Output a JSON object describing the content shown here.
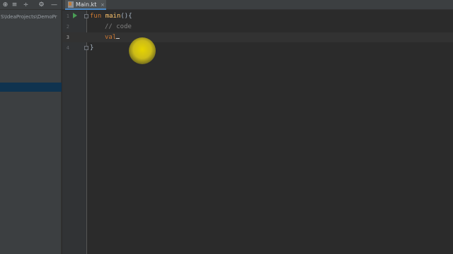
{
  "project_panel": {
    "toolbar_icons": [
      "target-icon",
      "expand-all-icon",
      "collapse-all-icon",
      "gear-icon",
      "minimize-icon"
    ],
    "path_text": "S\\IdeaProjects\\DemoPr"
  },
  "tabs": [
    {
      "label": "Main.kt",
      "close": "×",
      "icon": "kotlin-file-icon"
    }
  ],
  "editor": {
    "line_numbers": [
      "1",
      "2",
      "3",
      "4"
    ],
    "lines": {
      "l1_kw": "fun",
      "l1_fn": "main",
      "l1_rest": "(){",
      "l2_comment": "// code",
      "l3_kw": "val",
      "l4_brace": "}"
    },
    "current_line": 3
  },
  "colors": {
    "editor_bg": "#2b2b2b",
    "keyword": "#cc7832",
    "function": "#ffc66d",
    "comment": "#808080",
    "selection": "#0d293e"
  }
}
